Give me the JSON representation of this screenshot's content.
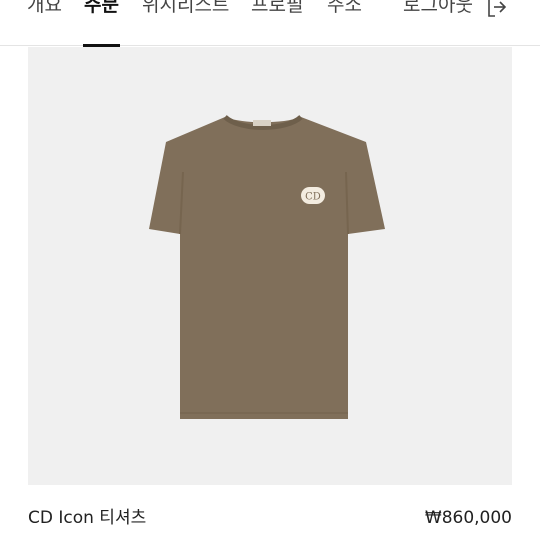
{
  "nav": {
    "tabs": [
      {
        "label": "개요",
        "active": false
      },
      {
        "label": "주문",
        "active": true
      },
      {
        "label": "위시리스트",
        "active": false
      },
      {
        "label": "프로필",
        "active": false
      },
      {
        "label": "주소",
        "active": false
      }
    ],
    "logout_label": "로그아웃",
    "logout_icon": "logout-icon"
  },
  "product": {
    "image_icon": "tshirt-image",
    "logo_text": "CD",
    "name": "CD Icon 티셔츠",
    "price": "₩860,000"
  },
  "colors": {
    "tshirt": "#806f5a",
    "image_background": "#f0f0f0",
    "active_underline": "#111111"
  }
}
